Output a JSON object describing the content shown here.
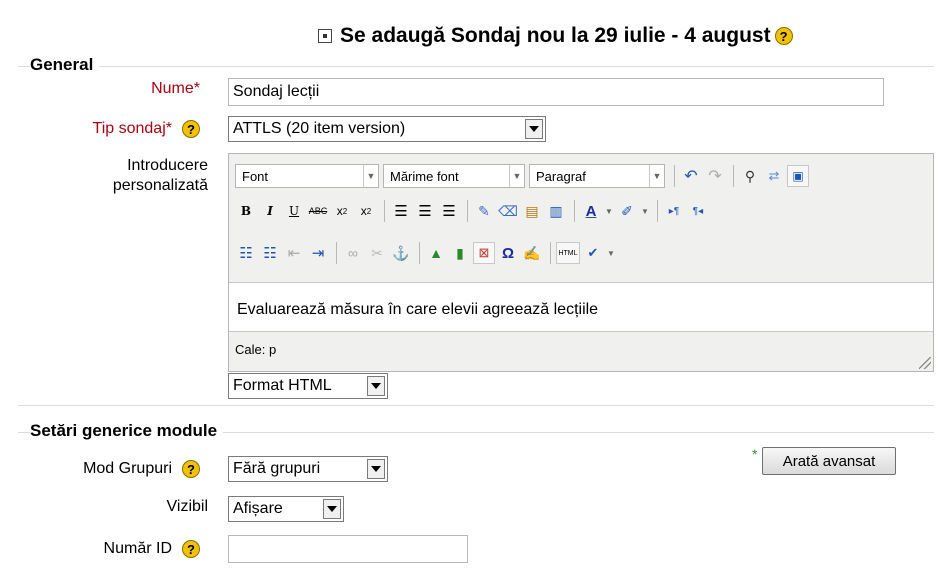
{
  "header": {
    "title": "Se adaugă Sondaj nou la 29 iulie - 4 august",
    "help": "?"
  },
  "general": {
    "legend": "General",
    "name": {
      "label": "Nume",
      "required_mark": "*",
      "value": "Sondaj lecții"
    },
    "survey_type": {
      "label": "Tip sondaj",
      "required_mark": "*",
      "selected": "ATTLS (20 item version)"
    },
    "custom_intro": {
      "label_line1": "Introducere",
      "label_line2": "personalizată",
      "toolbar": {
        "font": "Font",
        "font_size": "Mărime font",
        "paragraph": "Paragraf"
      },
      "content": "Evaluarează măsura în care elevii agreează lecțiile",
      "path": "Cale: p",
      "format": "Format HTML"
    }
  },
  "generic": {
    "legend": "Setări generice module",
    "group_mode": {
      "label": "Mod Grupuri",
      "selected": "Fără grupuri"
    },
    "visible": {
      "label": "Vizibil",
      "selected": "Afișare"
    },
    "id_number": {
      "label": "Număr ID",
      "value": ""
    },
    "advanced_mark": "*",
    "advanced_button": "Arată avansat"
  },
  "icons": {
    "help": "help-icon",
    "collapse": "collapse-icon"
  },
  "colors": {
    "required": "#b0000f",
    "help": "#f2c200"
  }
}
